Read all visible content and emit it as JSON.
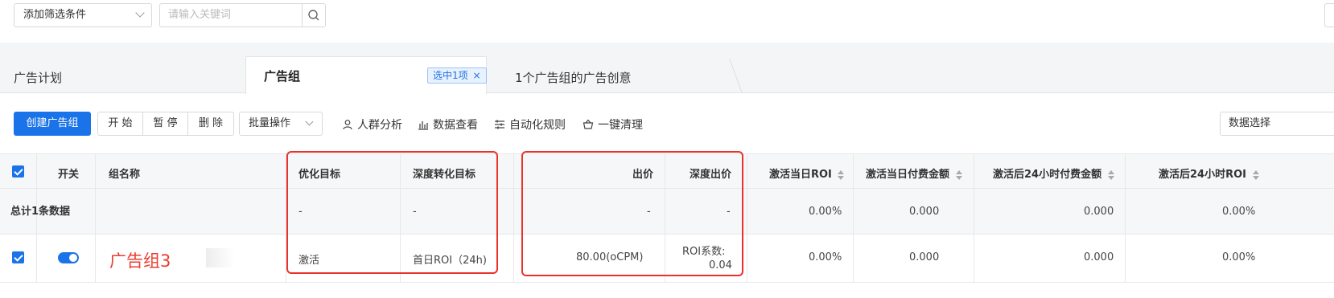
{
  "filter": {
    "add_filter_label": "添加筛选条件",
    "keyword_placeholder": "请输入关键词"
  },
  "tabs": {
    "plan": "广告计划",
    "group": "广告组",
    "selected_badge": "选中1项",
    "creative": "1个广告组的广告创意"
  },
  "toolbar": {
    "create": "创建广告组",
    "start": "开 始",
    "pause": "暂 停",
    "delete": "删 除",
    "batch": "批量操作",
    "audience": "人群分析",
    "data_view": "数据查看",
    "automation": "自动化规则",
    "cleanup": "一键清理",
    "data_right": "数据选择"
  },
  "table": {
    "headers": {
      "switch": "开关",
      "name": "组名称",
      "opt_goal": "优化目标",
      "deep_goal": "深度转化目标",
      "bid": "出价",
      "deep_bid": "深度出价",
      "roi_day1": "激活当日ROI",
      "pay_day1": "激活当日付费金额",
      "pay_24h": "激活后24小时付费金额",
      "roi_24h": "激活后24小时ROI"
    },
    "summary": {
      "label": "总计1条数据",
      "opt_goal": "-",
      "deep_goal": "-",
      "bid": "-",
      "deep_bid": "-",
      "roi_day1": "0.00%",
      "pay_day1": "0.000",
      "pay_24h": "0.000",
      "roi_24h": "0.00%"
    },
    "row": {
      "name": "广告组3",
      "opt_goal": "激活",
      "deep_goal": "首日ROI（24h)",
      "bid": "80.00(oCPM)",
      "deep_bid_line1": "ROI系数:",
      "deep_bid_line2": "0.04",
      "roi_day1": "0.00%",
      "pay_day1": "0.000",
      "pay_24h": "0.000",
      "roi_24h": "0.00%"
    }
  },
  "colors": {
    "primary": "#1a73e8",
    "highlight": "#e8322a"
  }
}
